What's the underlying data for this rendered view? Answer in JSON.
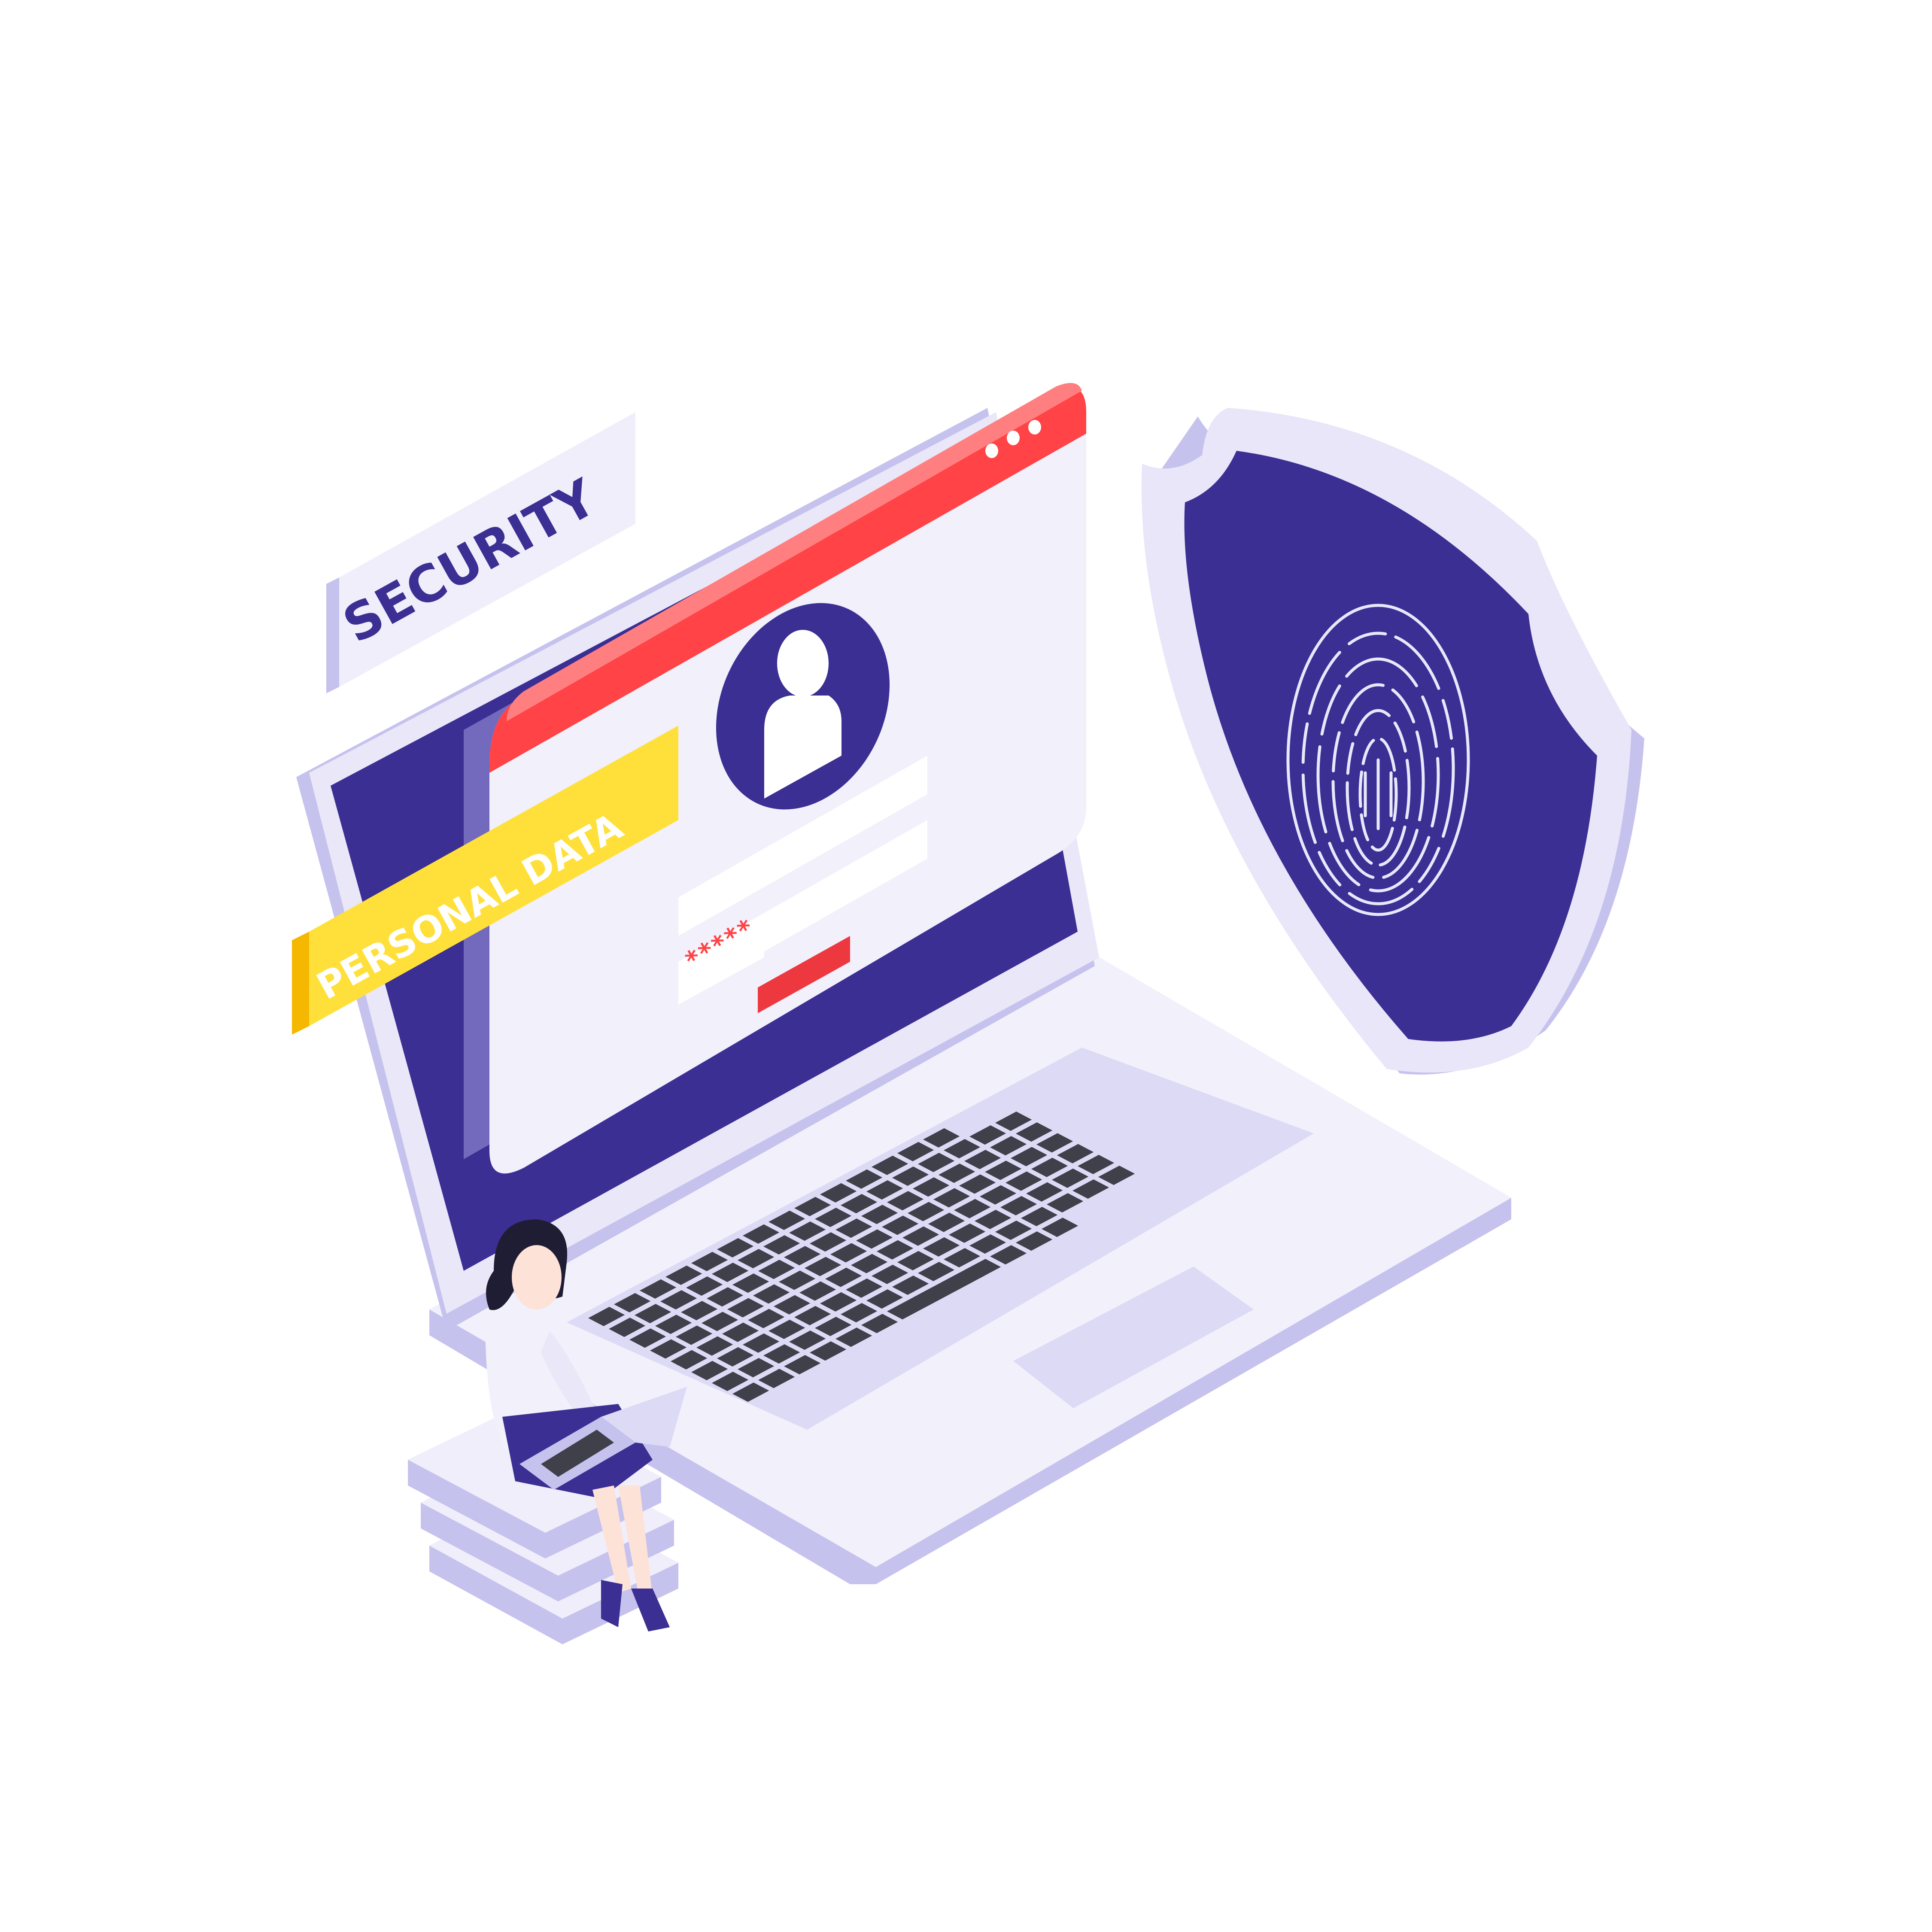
{
  "illustration": {
    "labels": {
      "security": "SECURITY",
      "personal_data": "PERSONAL DATA"
    },
    "login_window": {
      "window_dots": [
        "dot",
        "dot",
        "dot"
      ],
      "user_icon": "user-avatar-icon",
      "username_field": "",
      "email_field": "",
      "password_value": "*****",
      "submit_button_label": ""
    },
    "shield": {
      "icon": "fingerprint-icon"
    },
    "colors": {
      "background": "#ffffff",
      "navy": "#3b2f94",
      "red": "#ff4346",
      "lavender": "#dcdaf5",
      "light_panel": "#f1f0fb",
      "yellow": "#ffe03a",
      "key": "#40404a"
    }
  }
}
